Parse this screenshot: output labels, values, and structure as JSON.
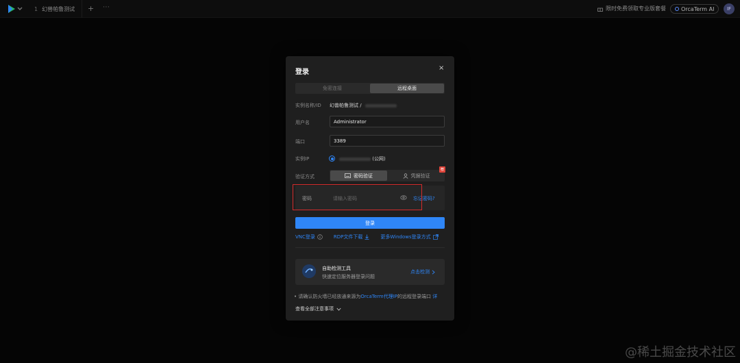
{
  "topbar": {
    "tab_number": "1",
    "tab_title": "幻兽帕鲁测试",
    "add_tab": "+",
    "more": "⋯",
    "promo_text": "限时免费领取专业版套餐",
    "ai_label": "OrcaTerm AI",
    "avatar_text": "IF"
  },
  "dialog": {
    "title": "登录",
    "close": "×",
    "tabs": [
      "免密连接",
      "远程桌面"
    ],
    "instance_label": "实例名称/ID",
    "instance_value": "幻兽帕鲁测试 /",
    "username_label": "用户名",
    "username_value": "Administrator",
    "port_label": "端口",
    "port_value": "3389",
    "ip_label": "实例IP",
    "ip_suffix": "(公网)",
    "auth_label": "验证方式",
    "auth_options": [
      "密码验证",
      "凭据验证"
    ],
    "auth_badge": "荐",
    "password_label": "密码",
    "password_placeholder": "请输入密码",
    "forgot_password": "忘记密码?",
    "login_button": "登录",
    "links": [
      "VNC登录",
      "RDP文件下载",
      "更多Windows登录方式"
    ],
    "tool_title": "自助检测工具",
    "tool_subtitle": "快速定位服务器登录问题",
    "tool_action": "点击检测",
    "notice_prefix": "• 请确认防火墙已经放通来源为",
    "notice_highlight": "OrcaTerm代理IP",
    "notice_suffix": "的远程登录端口",
    "notice_more": "详",
    "view_all": "查看全部注意事项"
  },
  "watermark": "@稀土掘金技术社区",
  "colors": {
    "accent": "#2f86f7",
    "alert": "#d62b2b",
    "badge": "#e0453b"
  }
}
